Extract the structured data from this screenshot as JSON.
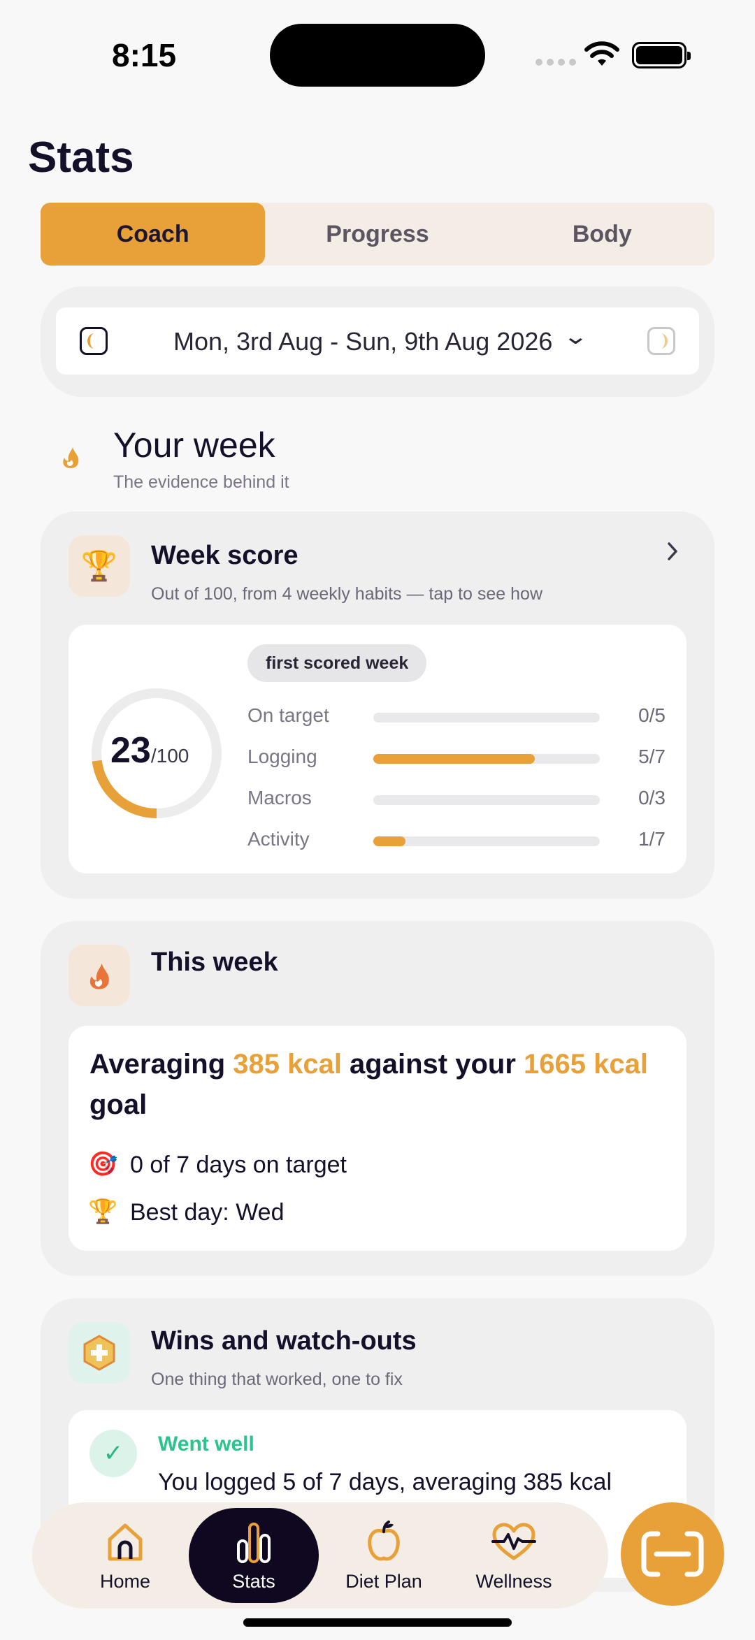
{
  "status_bar": {
    "time": "8:15"
  },
  "page": {
    "title": "Stats"
  },
  "tabs": [
    {
      "label": "Coach",
      "active": true
    },
    {
      "label": "Progress",
      "active": false
    },
    {
      "label": "Body",
      "active": false
    }
  ],
  "date_range": {
    "label": "Mon, 3rd Aug - Sun, 9th Aug 2026"
  },
  "your_week": {
    "title": "Your week",
    "subtitle": "The evidence behind it"
  },
  "week_score": {
    "title": "Week score",
    "subtitle": "Out of 100, from 4 weekly habits — tap to see how",
    "score": "23",
    "score_max": "/100",
    "score_fraction": 0.23,
    "badge": "first scored week",
    "metrics": [
      {
        "label": "On target",
        "value": "0/5",
        "fraction": 0
      },
      {
        "label": "Logging",
        "value": "5/7",
        "fraction": 0.714
      },
      {
        "label": "Macros",
        "value": "0/3",
        "fraction": 0
      },
      {
        "label": "Activity",
        "value": "1/7",
        "fraction": 0.143
      }
    ]
  },
  "this_week": {
    "title": "This week",
    "avg_prefix": "Averaging ",
    "avg_kcal": "385 kcal",
    "avg_middle": " against your ",
    "goal_kcal": "1665 kcal",
    "avg_suffix": " goal",
    "days_on_target": "0 of 7 days on target",
    "best_day": "Best day: Wed"
  },
  "wins": {
    "title": "Wins and watch-outs",
    "subtitle": "One thing that worked, one to fix",
    "went_well_title": "Went well",
    "went_well_text": "You logged 5 of 7 days, averaging 385 kcal"
  },
  "nav": [
    {
      "label": "Home",
      "icon": "home-icon",
      "active": false
    },
    {
      "label": "Stats",
      "icon": "stats-icon",
      "active": true
    },
    {
      "label": "Diet Plan",
      "icon": "apple-icon",
      "active": false
    },
    {
      "label": "Wellness",
      "icon": "heart-pulse-icon",
      "active": false
    }
  ],
  "colors": {
    "accent": "#e8a038",
    "dark": "#0f0820",
    "success": "#2bc48c"
  }
}
